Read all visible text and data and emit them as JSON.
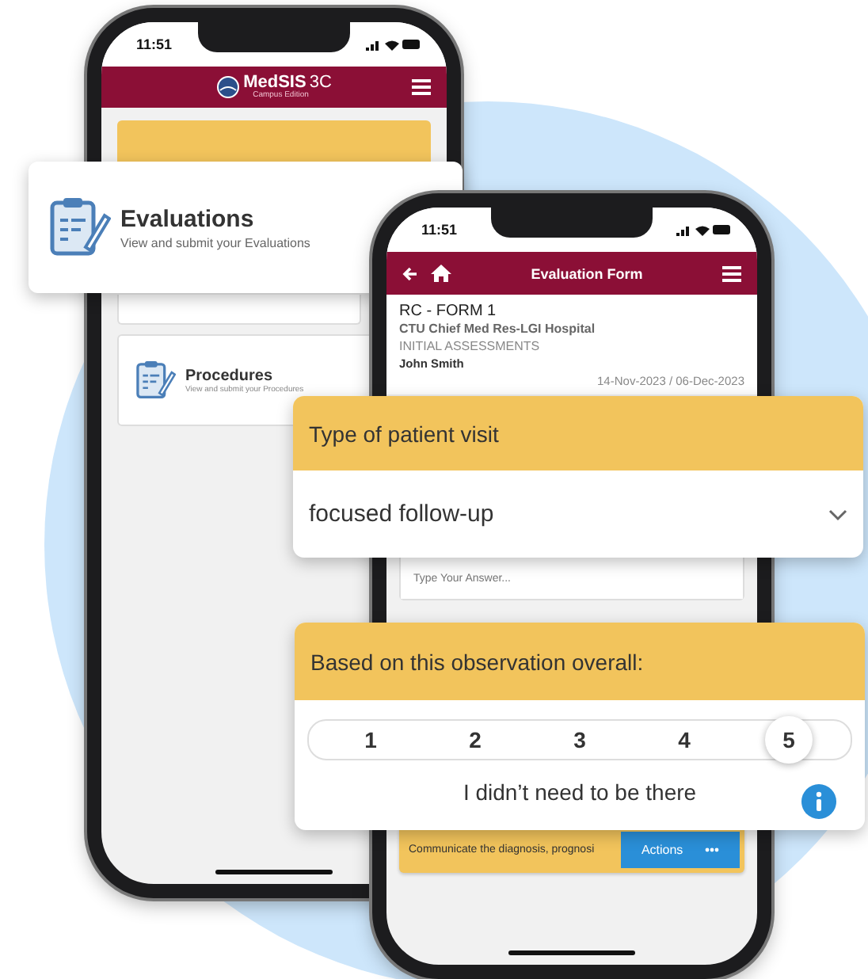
{
  "home_screen": {
    "time": "11:51",
    "logo": {
      "name": "MedSIS",
      "suffix": "3C",
      "subtitle": "Campus Edition"
    },
    "cards": [
      {
        "title": "Procedures",
        "description": "View and submit your Procedures"
      }
    ]
  },
  "evaluations_card": {
    "title": "Evaluations",
    "description": "View and submit your Evaluations"
  },
  "form_screen": {
    "time": "11:51",
    "title": "Evaluation Form",
    "form_name": "RC - FORM 1",
    "service": "CTU Chief Med Res-LGI Hospital",
    "assessment": "INITIAL ASSESSMENTS",
    "person": "John Smith",
    "dates": "14-Nov-2023 / 06-Dec-2023",
    "answer_placeholder": "Type Your Answer...",
    "item_text": "Communicate the diagnosis, prognosi",
    "actions_button": "Actions"
  },
  "visit_type_card": {
    "label": "Type of patient visit",
    "value": "focused follow-up"
  },
  "rating_card": {
    "label": "Based on this observation overall:",
    "options": [
      {
        "label": "1",
        "selected": false
      },
      {
        "label": "2",
        "selected": false
      },
      {
        "label": "3",
        "selected": false
      },
      {
        "label": "4",
        "selected": false
      },
      {
        "label": "5",
        "selected": true
      }
    ],
    "selection_text": "I didn’t need to be there"
  }
}
